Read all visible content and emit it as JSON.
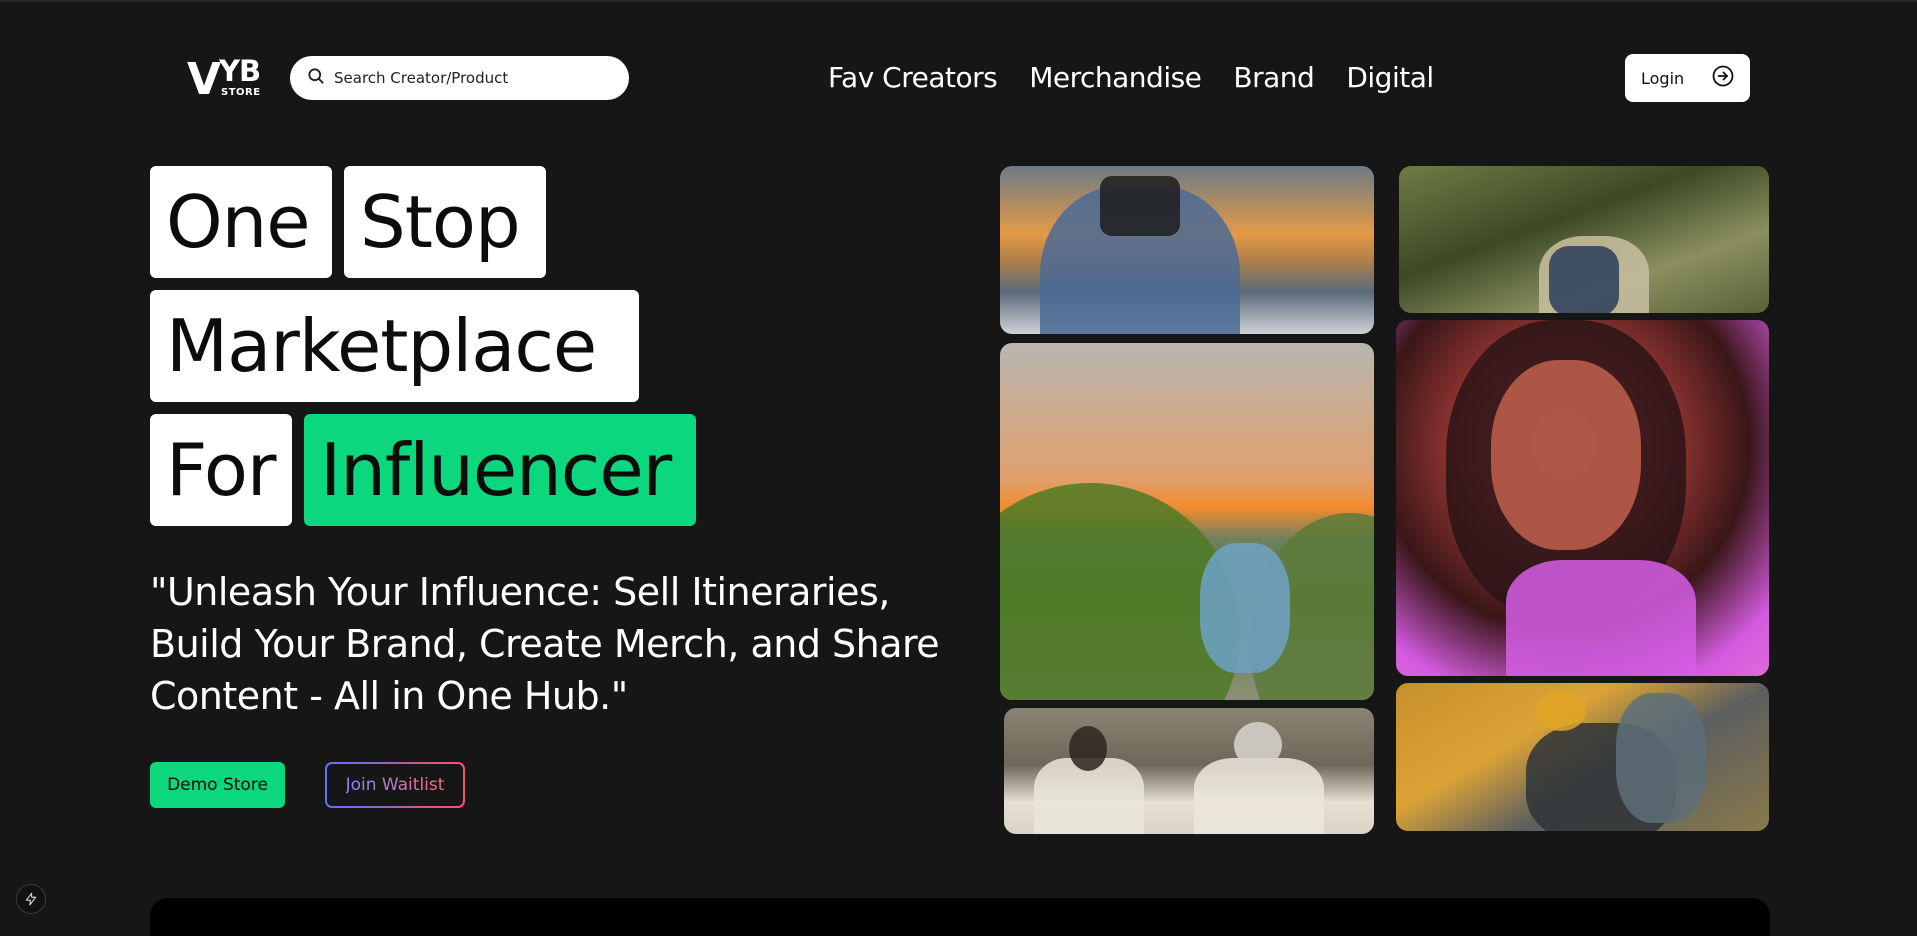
{
  "header": {
    "logo_main": "VYB",
    "logo_sub": "STORE",
    "search_placeholder": "Search Creator/Product",
    "nav": [
      "Fav Creators",
      "Merchandise",
      "Brand",
      "Digital"
    ],
    "login_label": "Login"
  },
  "hero": {
    "words": {
      "one": "One",
      "stop": "Stop",
      "marketplace": "Marketplace",
      "for": "For",
      "influencer": "Influencer"
    },
    "tagline": "\"Unleash Your Influence: Sell Itineraries, Build Your Brand, Create Merch, and Share Content - All in One Hub.\"",
    "demo_button": "Demo Store",
    "waitlist_button": "Join Waitlist"
  },
  "colors": {
    "background": "#161616",
    "accent_green": "#0ad77e",
    "gradient_start": "#5b74f5",
    "gradient_end": "#f4536b"
  },
  "icons": {
    "search": "search-icon",
    "login": "arrow-right-circle-icon",
    "bolt": "lightning-bolt-icon"
  }
}
